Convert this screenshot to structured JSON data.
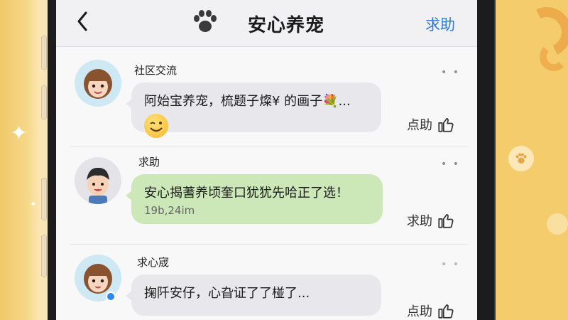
{
  "header": {
    "title": "安心养宠",
    "help_label": "求助",
    "icons": {
      "back": "chevron-left-icon",
      "logo": "paw-icon"
    }
  },
  "posts": [
    {
      "username": "社区交流",
      "message": "阿始宝养宠，梳题子燦¥ 的画子💐...",
      "emoji": "winking-smile-emoji",
      "bubble_color": "#e8e8ec",
      "action_label": "点助"
    },
    {
      "username": "求助",
      "message": "安心揭蓍养顷奎口犹犹先哈正了选！",
      "subtext": "19b,24im",
      "bubble_color": "#cde8b8",
      "action_label": "求助"
    },
    {
      "username": "求心宬",
      "message": "掬阡安仔，心旮证了了椪了...",
      "bubble_color": "#e8e8ec",
      "action_label": "点助",
      "online": true
    }
  ],
  "colors": {
    "accent": "#2e7bd6",
    "background": "#f4cd72",
    "online": "#2f86ef"
  }
}
